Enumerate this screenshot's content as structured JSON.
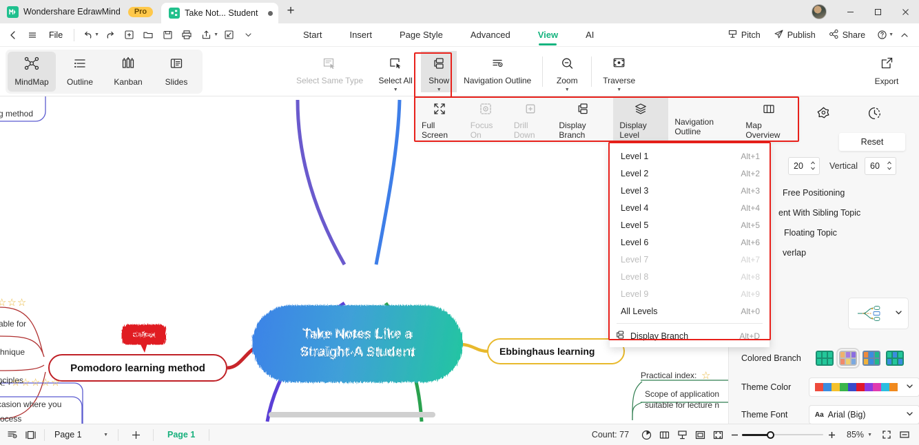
{
  "titlebar": {
    "brand": "Wondershare EdrawMind",
    "pro_badge": "Pro",
    "doc_tab": "Take Not... Student",
    "new_tab": "+",
    "minimize": "—",
    "maximize": "☐",
    "close": "✕"
  },
  "menubar": {
    "file": "File",
    "tabs": [
      {
        "label": "Start",
        "active": false
      },
      {
        "label": "Insert",
        "active": false
      },
      {
        "label": "Page Style",
        "active": false
      },
      {
        "label": "Advanced",
        "active": false
      },
      {
        "label": "View",
        "active": true
      },
      {
        "label": "AI",
        "active": false
      }
    ],
    "right": [
      {
        "label": "Pitch",
        "icon": "pitch-icon"
      },
      {
        "label": "Publish",
        "icon": "publish-icon"
      },
      {
        "label": "Share",
        "icon": "share-icon"
      }
    ],
    "help": "?",
    "collapse": "^"
  },
  "ribbon": {
    "view_modes": [
      {
        "label": "MindMap",
        "icon": "mindmap-icon",
        "active": true
      },
      {
        "label": "Outline",
        "icon": "outline-icon",
        "active": false
      },
      {
        "label": "Kanban",
        "icon": "kanban-icon",
        "active": false
      },
      {
        "label": "Slides",
        "icon": "slides-icon",
        "active": false
      }
    ],
    "tools": [
      {
        "label": "Select Same Type",
        "icon": "select-same-type-icon",
        "disabled": true,
        "caret": false
      },
      {
        "label": "Select All",
        "icon": "select-all-icon",
        "disabled": false,
        "caret": true
      },
      {
        "label": "Show",
        "icon": "show-icon",
        "disabled": false,
        "caret": true,
        "selected": true
      },
      {
        "label": "Navigation Outline",
        "icon": "navigation-outline-icon",
        "disabled": false,
        "caret": false
      },
      {
        "label": "Zoom",
        "icon": "zoom-icon",
        "disabled": false,
        "caret": true
      },
      {
        "label": "Traverse",
        "icon": "traverse-icon",
        "disabled": false,
        "caret": true
      }
    ],
    "export": {
      "label": "Export",
      "icon": "export-icon"
    }
  },
  "show_flyout": {
    "items": [
      {
        "label": "Full Screen",
        "icon": "full-screen-icon",
        "disabled": false,
        "caret": false,
        "selected": false
      },
      {
        "label": "Focus On",
        "icon": "focus-on-icon",
        "disabled": true,
        "caret": false,
        "selected": false
      },
      {
        "label": "Drill Down",
        "icon": "drill-down-icon",
        "disabled": true,
        "caret": false,
        "selected": false
      },
      {
        "label": "Display Branch",
        "icon": "display-branch-icon",
        "disabled": false,
        "caret": false,
        "selected": false
      },
      {
        "label": "Display Level",
        "icon": "display-level-icon",
        "disabled": false,
        "caret": true,
        "selected": true
      },
      {
        "label": "Navigation Outline",
        "icon": "navigation-outline-icon",
        "disabled": false,
        "caret": false,
        "selected": false
      },
      {
        "label": "Map Overview",
        "icon": "map-overview-icon",
        "disabled": false,
        "caret": false,
        "selected": false
      }
    ]
  },
  "display_level_menu": {
    "items": [
      {
        "label": "Level 1",
        "shortcut": "Alt+1",
        "disabled": false
      },
      {
        "label": "Level 2",
        "shortcut": "Alt+2",
        "disabled": false
      },
      {
        "label": "Level 3",
        "shortcut": "Alt+3",
        "disabled": false
      },
      {
        "label": "Level 4",
        "shortcut": "Alt+4",
        "disabled": false
      },
      {
        "label": "Level 5",
        "shortcut": "Alt+5",
        "disabled": false
      },
      {
        "label": "Level 6",
        "shortcut": "Alt+6",
        "disabled": false
      },
      {
        "label": "Level 7",
        "shortcut": "Alt+7",
        "disabled": true
      },
      {
        "label": "Level 8",
        "shortcut": "Alt+8",
        "disabled": true
      },
      {
        "label": "Level 9",
        "shortcut": "Alt+9",
        "disabled": true
      },
      {
        "label": "All Levels",
        "shortcut": "Alt+0",
        "disabled": false
      }
    ],
    "footer": {
      "label": "Display Branch",
      "shortcut": "Alt+D",
      "icon": "display-branch-icon"
    }
  },
  "canvas": {
    "central_line1": "Take Notes Like a",
    "central_line2": "Straight-A Student",
    "pomodoro": "Pomodoro learning method",
    "ebbinghaus": "Ebbinghaus learning",
    "callout": "Callout",
    "clipped_top": "g method",
    "clipped_left": [
      "able for",
      "chnique",
      "inciples",
      "rocess"
    ],
    "clipped_bottom": "casion where you",
    "clipped_bottom_label": "x:",
    "stars_top": "☆☆☆",
    "stars_bottom": "☆☆☆☆☆",
    "practical_index": "Practical index:",
    "practical_star": "☆",
    "scope_line1": "Scope of application",
    "scope_line2": "suitable for lecture n",
    "colors": {
      "central_from": "#3b82e8",
      "central_to": "#22c6a0",
      "pomodoro_border": "#bf2026",
      "ebbinghaus_border": "#e8b92c",
      "callout_bg": "#e01b23"
    }
  },
  "right_panel": {
    "top_icons": [
      "smiley-pin-icon",
      "flower-icon",
      "clock-dash-icon"
    ],
    "reset": "Reset",
    "spacing_value": "20",
    "vertical_label": "Vertical",
    "vertical_value": "60",
    "checks": [
      "Free Positioning",
      "ent With Sibling Topic",
      "Floating Topic",
      "verlap"
    ],
    "colored_branch_label": "Colored Branch",
    "theme_color_label": "Theme Color",
    "theme_font_label": "Theme Font",
    "theme_font_value": "Arial (Big)",
    "theme_font_prefix": "Aa",
    "theme_colors": [
      "#ee4b3c",
      "#3a8de0",
      "#f5c22d",
      "#39b54a",
      "#3a49c9",
      "#e0182b",
      "#8b3ae0",
      "#e03ab0",
      "#2bbde0",
      "#f08a1e"
    ],
    "branch_swatches": [
      {
        "selected": false,
        "colors": [
          "#1fb98a",
          "#1fb98a",
          "#1fb98a",
          "#1fb98a",
          "#1fb98a",
          "#1fb98a"
        ]
      },
      {
        "selected": true,
        "colors": [
          "#f0b26b",
          "#a77ce0",
          "#8b6ee0",
          "#f08a6b",
          "#f0d06b",
          "#7ba9e0"
        ]
      },
      {
        "selected": false,
        "colors": [
          "#f08a3c",
          "#3a8de0",
          "#1fb98a",
          "#f0b23c",
          "#3a8de0",
          "#1fb98a"
        ]
      },
      {
        "selected": false,
        "colors": [
          "#1fb98a",
          "#3a8de0",
          "#1fb98a",
          "#3a8de0",
          "#1fb98a",
          "#3a8de0"
        ]
      }
    ]
  },
  "statusbar": {
    "page_select": "Page 1",
    "add_page": "+",
    "page_tab": "Page 1",
    "count": "Count: 77",
    "zoom_minus": "−",
    "zoom_plus": "+",
    "zoom_level": "85%",
    "icons": [
      "outline-pin-icon",
      "panel-icon",
      "pie-icon",
      "book-icon",
      "pitch-icon",
      "frame-icon",
      "fit-icon",
      "fullscreen-icon",
      "split-icon"
    ]
  }
}
